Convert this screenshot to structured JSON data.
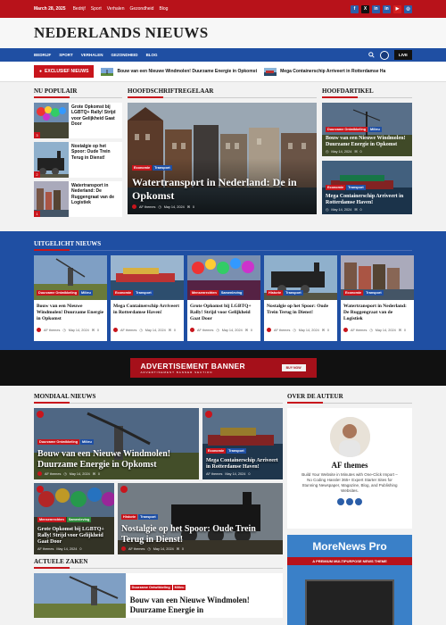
{
  "topbar": {
    "date": "March 28, 2025",
    "links": [
      "Bedrijf",
      "Sport",
      "Verhalen",
      "Gezondheid",
      "Blog"
    ],
    "socials": [
      "f",
      "X",
      "in",
      "in",
      "▶",
      "◎"
    ]
  },
  "site": {
    "title": "NEDERLANDS NIEUWS"
  },
  "nav": {
    "items": [
      "BEDRIJF",
      "SPORT",
      "VERHALEN",
      "GEZONDHEID",
      "BLOG"
    ],
    "live": "LIVE"
  },
  "ticker": {
    "label": "EXCLUSIEF NIEUWS",
    "items": [
      "Bouw van een Nieuwe Windmolen! Duurzame Energie in Opkomst",
      "Mega Containerschip Arriveert in Rotterdamse Ha"
    ]
  },
  "sections": {
    "popular": "NU POPULAIR",
    "headline": "HOOFDSCHRIFTREGELAAR",
    "main": "HOOFDARTIKEL",
    "featured": "UITGELICHT NIEUWS",
    "world": "MONDIAAL NIEUWS",
    "author": "OVER DE AUTEUR",
    "current": "ACTUELE ZAKEN"
  },
  "popular": [
    {
      "title": "Grote Opkomst bij LGBTQ+ Rally! Strijd voor Gelijkheid Gaat Door",
      "num": "3"
    },
    {
      "title": "Nostalgie op het Spoor: Oude Trein Terug in Dienst!",
      "num": "2"
    },
    {
      "title": "Watertransport in Nederland: De Ruggengraat van de Logistiek",
      "num": "1"
    }
  ],
  "hero": {
    "cats": [
      "Economie",
      "Transport"
    ],
    "title": "Watertransport in Nederland: De in Opkomst",
    "author": "AF themes",
    "date": "May 14, 2024",
    "comments": "0"
  },
  "main_articles": [
    {
      "cats": [
        "Duurzame Ontwikkeling",
        "Milieu"
      ],
      "title": "Bouw van een Nieuwe Windmolen! Duurzame Energie in Opkomst",
      "date": "May 14, 2024",
      "comments": "0"
    },
    {
      "cats": [
        "Economie",
        "Transport"
      ],
      "title": "Mega Containerschip Arriveert in Rotterdamse Haven!",
      "date": "May 14, 2024",
      "comments": "0"
    }
  ],
  "featured": [
    {
      "cats": [
        "Duurzame Ontwikkeling",
        "Milieu"
      ],
      "title": "Bouw van een Nieuwe Windmolen! Duurzame Energie in Opkomst",
      "author": "AF themes",
      "date": "May 14, 2024",
      "comments": "0"
    },
    {
      "cats": [
        "Economie",
        "Transport"
      ],
      "title": "Mega Containerschip Arriveert in Rotterdamse Haven!",
      "author": "AF themes",
      "date": "May 14, 2024",
      "comments": "0"
    },
    {
      "cats": [
        "Mensenrechten",
        "Samenleving"
      ],
      "title": "Grote Opkomst bij LGBTQ+ Rally! Strijd voor Gelijkheid Gaat Door",
      "author": "AF themes",
      "date": "May 14, 2024",
      "comments": "0"
    },
    {
      "cats": [
        "Historie",
        "Transport"
      ],
      "title": "Nostalgie op het Spoor: Oude Trein Terug in Dienst!",
      "author": "AF themes",
      "date": "May 14, 2024",
      "comments": "0"
    },
    {
      "cats": [
        "Economie",
        "Transport"
      ],
      "title": "Watertransport in Nederland: De Ruggengraat van de Logistiek",
      "author": "AF themes",
      "date": "May 14, 2024",
      "comments": "0"
    }
  ],
  "advert": {
    "title": "ADVERTISEMENT BANNER",
    "sub": "ADVERTISEMENT BANNER SECTION",
    "button": "BUY NOW"
  },
  "world": [
    {
      "cats": [
        "Duurzame Ontwikkeling",
        "Milieu"
      ],
      "title": "Bouw van een Nieuwe Windmolen! Duurzame Energie in Opkomst",
      "author": "AF themes",
      "date": "May 14, 2024",
      "comments": "0"
    },
    {
      "cats": [
        "Economie",
        "Transport"
      ],
      "title": "Mega Containerschip Arriveert in Rotterdamse Haven!",
      "author": "AF themes",
      "date": "May 14, 2024",
      "comments": "0"
    },
    {
      "cats": [
        "Mensenrechten",
        "Samenleving"
      ],
      "title": "Grote Opkomst bij LGBTQ+ Rally! Strijd voor Gelijkheid Gaat Door",
      "author": "AF themes",
      "date": "May 14, 2024",
      "comments": "0"
    },
    {
      "cats": [
        "Historie",
        "Transport"
      ],
      "title": "Nostalgie op het Spoor: Oude Trein Terug in Dienst!",
      "author": "AF themes",
      "date": "May 14, 2024",
      "comments": "0"
    }
  ],
  "author": {
    "name": "AF themes",
    "desc": "Build Your Website in Minutes with One-Click Import – No Coding Hassle! 365+ Expert Starter Sites for Stunning Newspaper, Magazine, Blog, and Publishing Websites."
  },
  "promo": {
    "title": "MoreNews Pro",
    "sub": "A PREMIUM MULTIPURPOSE NEWS THEME"
  },
  "current": {
    "cats": [
      "Duurzame Ontwikkeling",
      "Milieu"
    ],
    "title": "Bouw van een Nieuwe Windmolen! Duurzame Energie in"
  }
}
